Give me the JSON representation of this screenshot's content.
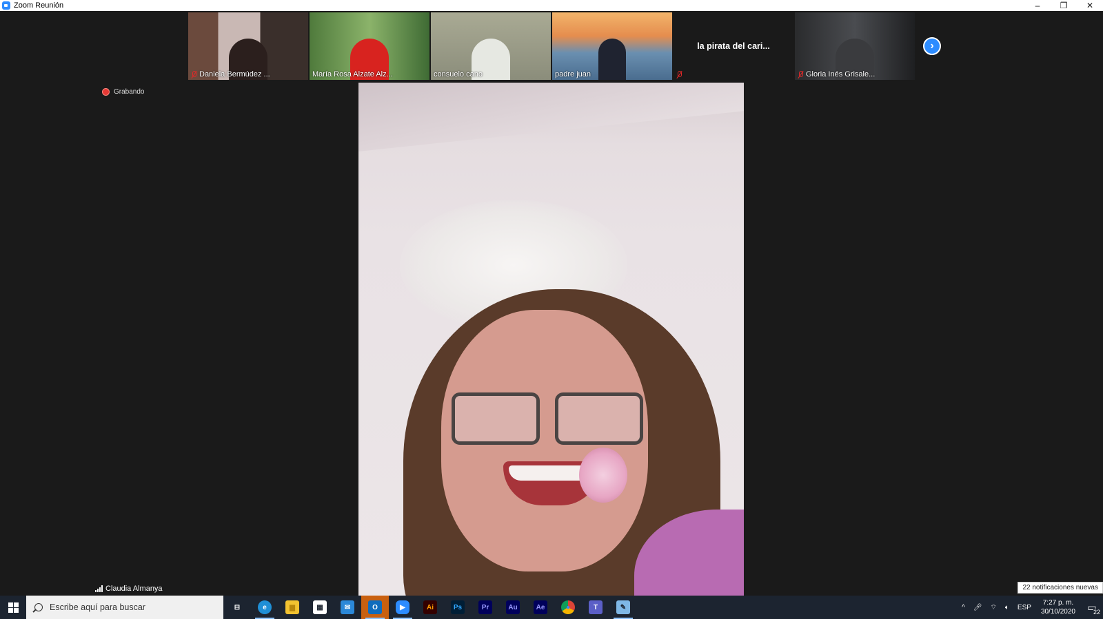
{
  "window": {
    "title": "Zoom Reunión",
    "minimize": "–",
    "restore": "❐",
    "close": "✕"
  },
  "participants": [
    {
      "name": "Daniela Bermúdez ...",
      "muted": true
    },
    {
      "name": "María Rosa Alzate Alz...",
      "muted": false
    },
    {
      "name": "consuelo cano",
      "muted": false
    },
    {
      "name": "padre juan",
      "muted": false
    },
    {
      "name": "la pirata del cari...",
      "muted": true,
      "video_off": true
    },
    {
      "name": "Gloria Inés Grisale...",
      "muted": true
    }
  ],
  "next_page_icon": "chevron-right-icon",
  "recording": {
    "label": "Grabando"
  },
  "active_speaker": {
    "name": "Claudia Almanya"
  },
  "notification_tooltip": "22 notificaciones nuevas",
  "taskbar": {
    "search_placeholder": "Escribe aquí para buscar",
    "apps": [
      {
        "name": "task-view",
        "glyph": "⊟",
        "color": "#1c2430"
      },
      {
        "name": "edge",
        "glyph": "e",
        "color": "#1f8fd6"
      },
      {
        "name": "file-explorer",
        "glyph": "▆",
        "color": "#f2c230"
      },
      {
        "name": "store",
        "glyph": "▦",
        "color": "#ffffff"
      },
      {
        "name": "mail",
        "glyph": "✉",
        "color": "#2b88d8"
      },
      {
        "name": "outlook",
        "glyph": "O",
        "color": "#0f6cbd"
      },
      {
        "name": "zoom",
        "glyph": "▶",
        "color": "#2d8cff"
      },
      {
        "name": "illustrator",
        "glyph": "Ai",
        "color": "#330000"
      },
      {
        "name": "photoshop",
        "glyph": "Ps",
        "color": "#001e36"
      },
      {
        "name": "premiere",
        "glyph": "Pr",
        "color": "#00005b"
      },
      {
        "name": "audition",
        "glyph": "Au",
        "color": "#00005b"
      },
      {
        "name": "after-effects",
        "glyph": "Ae",
        "color": "#00005b"
      },
      {
        "name": "chrome",
        "glyph": "●",
        "color": "#e0b020"
      },
      {
        "name": "teams",
        "glyph": "T",
        "color": "#5b5fc7"
      },
      {
        "name": "paint",
        "glyph": "✎",
        "color": "#7fb8e6"
      }
    ],
    "tray": {
      "language": "ESP",
      "time": "7:27 p. m.",
      "date": "30/10/2020",
      "notifications": "22"
    }
  },
  "colors": {
    "accent": "#2d8cff",
    "recording": "#e53935",
    "muted": "#e02828"
  }
}
